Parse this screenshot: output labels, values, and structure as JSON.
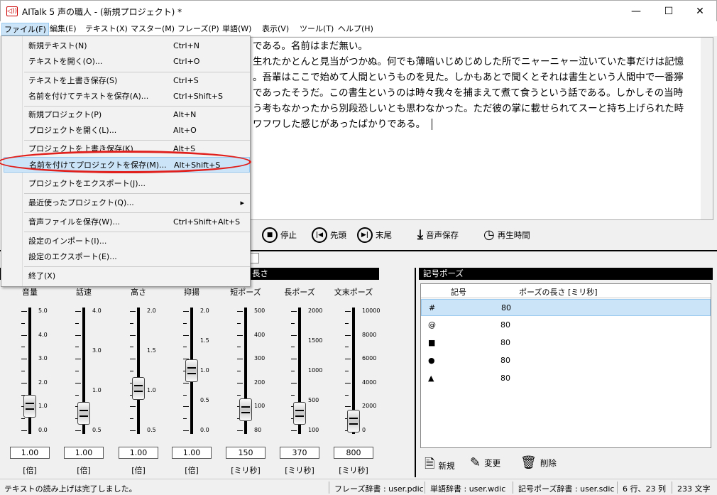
{
  "window": {
    "title": "AITalk 5 声の職人 - (新規プロジェクト) *",
    "minimize": "—",
    "maximize": "☐",
    "close": "✕"
  },
  "menubar": [
    "ファイル(F)",
    "編集(E)",
    "テキスト(X)",
    "マスター(M)",
    "フレーズ(P)",
    "単語(W)",
    "表示(V)",
    "ツール(T)",
    "ヘルプ(H)"
  ],
  "text_lines": [
    "である。名前はまだ無い。",
    "生れたかとんと見当がつかぬ。何でも薄暗いじめじめした所でニャーニャー泣いていた事だけは記憶",
    "。吾輩はここで始めて人間というものを見た。しかもあとで聞くとそれは書生という人間中で一番獰",
    "であったそうだ。この書生というのは時々我々を捕まえて煮て食うという話である。しかしその当時",
    "う考もなかったから別段恐しいとも思わなかった。ただ彼の掌に載せられてスーと持ち上げられた時",
    "ワフワした感じがあったばかりである。"
  ],
  "play": {
    "stop": "停止",
    "head": "先頭",
    "tail": "末尾",
    "save": "音声保存",
    "time": "再生時間"
  },
  "left_panel": {
    "header": "長さ"
  },
  "sliders": [
    {
      "label": "音量",
      "value": "1.00",
      "unit": "[倍]",
      "ticks": [
        "5.0",
        "4.0",
        "3.0",
        "2.0",
        "1.0",
        "0.0"
      ],
      "level": 0.2
    },
    {
      "label": "話速",
      "value": "1.00",
      "unit": "[倍]",
      "ticks": [
        "4.0",
        "3.0",
        "1.0",
        "0.5"
      ],
      "level": 0.14
    },
    {
      "label": "高さ",
      "value": "1.00",
      "unit": "[倍]",
      "ticks": [
        "2.0",
        "1.5",
        "1.0",
        "0.5"
      ],
      "level": 0.35
    },
    {
      "label": "抑揚",
      "value": "1.00",
      "unit": "[倍]",
      "ticks": [
        "2.0",
        "1.5",
        "1.0",
        "0.5",
        "0.0"
      ],
      "level": 0.5
    },
    {
      "label": "短ポーズ",
      "value": "150",
      "unit": "[ミリ秒]",
      "ticks": [
        "500",
        "400",
        "300",
        "200",
        "100",
        "80"
      ],
      "level": 0.17
    },
    {
      "label": "長ポーズ",
      "value": "370",
      "unit": "[ミリ秒]",
      "ticks": [
        "2000",
        "1500",
        "1000",
        "500",
        "100"
      ],
      "level": 0.14
    },
    {
      "label": "文末ポーズ",
      "value": "800",
      "unit": "[ミリ秒]",
      "ticks": [
        "10000",
        "8000",
        "6000",
        "4000",
        "2000",
        "0"
      ],
      "level": 0.08
    }
  ],
  "right_panel": {
    "header": "記号ポーズ",
    "col1": "記号",
    "col2": "ポーズの長さ [ミリ秒]",
    "rows": [
      {
        "sym": "#",
        "val": "80"
      },
      {
        "sym": "@",
        "val": "80"
      },
      {
        "sym": "■",
        "val": "80"
      },
      {
        "sym": "●",
        "val": "80"
      },
      {
        "sym": "▲",
        "val": "80"
      }
    ],
    "new": "新規",
    "edit": "変更",
    "delete": "削除"
  },
  "file_menu": [
    {
      "label": "新規テキスト(N)",
      "sc": "Ctrl+N"
    },
    {
      "label": "テキストを開く(O)...",
      "sc": "Ctrl+O"
    },
    {
      "label": "テキストを上書き保存(S)",
      "sc": "Ctrl+S"
    },
    {
      "label": "名前を付けてテキストを保存(A)...",
      "sc": "Ctrl+Shift+S"
    },
    {
      "label": "新規プロジェクト(P)",
      "sc": "Alt+N"
    },
    {
      "label": "プロジェクトを開く(L)...",
      "sc": "Alt+O"
    },
    {
      "label": "プロジェクトを上書き保存(K)",
      "sc": "Alt+S"
    },
    {
      "label": "名前を付けてプロジェクトを保存(M)...",
      "sc": "Alt+Shift+S"
    },
    {
      "label": "プロジェクトをエクスポート(J)...",
      "sc": ""
    },
    {
      "label": "最近使ったプロジェクト(Q)...",
      "sc": ""
    },
    {
      "label": "音声ファイルを保存(W)...",
      "sc": "Ctrl+Shift+Alt+S"
    },
    {
      "label": "設定のインポート(I)...",
      "sc": ""
    },
    {
      "label": "設定のエクスポート(E)...",
      "sc": ""
    },
    {
      "label": "終了(X)",
      "sc": ""
    }
  ],
  "status": {
    "msg": "テキストの読み上げは完了しました。",
    "phrase": "フレーズ辞書 : user.pdic",
    "word": "単語辞書 : user.wdic",
    "sym": "記号ポーズ辞書 : user.sdic",
    "pos": "6 行、23 列",
    "chars": "233 文字"
  }
}
